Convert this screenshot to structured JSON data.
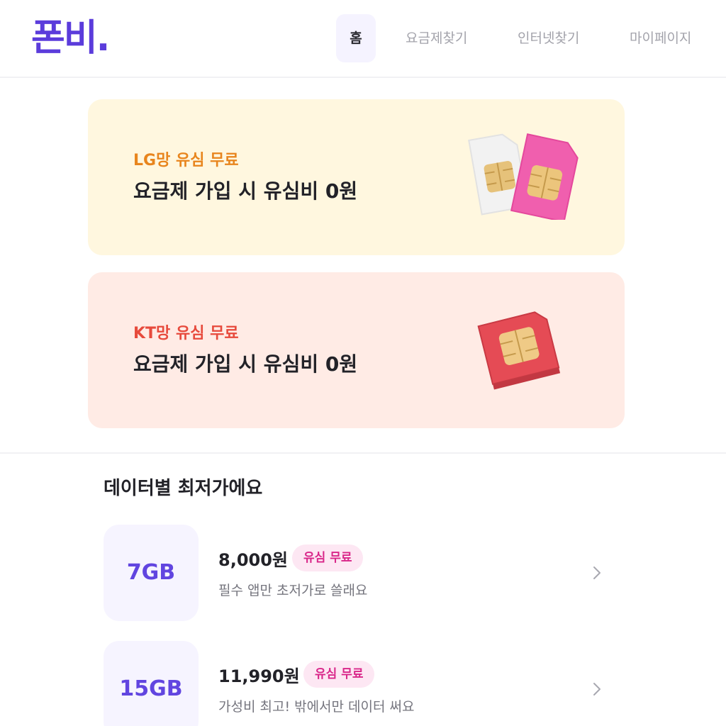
{
  "header": {
    "logo": "폰비.",
    "nav": {
      "home": "홈",
      "plan_search": "요금제찾기",
      "internet_search": "인터넷찾기",
      "my_page": "마이페이지"
    }
  },
  "banners": [
    {
      "tag": "LG망 유심 무료",
      "title": "요금제 가입 시 유심비 0원",
      "icon": "sim-card-icon"
    },
    {
      "tag": "KT망 유심 무료",
      "title": "요금제 가입 시 유심비 0원",
      "icon": "sim-card-icon"
    }
  ],
  "section": {
    "title": "데이터별 최저가에요"
  },
  "plans": [
    {
      "data": "7GB",
      "price": "8,000원",
      "badge": "유심 무료",
      "description": "필수 앱만 초저가로 쓸래요"
    },
    {
      "data": "15GB",
      "price": "11,990원",
      "badge": "유심 무료",
      "description": "가성비 최고! 밖에서만 데이터 써요"
    }
  ],
  "colors": {
    "brand": "#5b3cdb",
    "lg_banner_bg": "#fff7df",
    "kt_banner_bg": "#ffebe5",
    "badge_bg": "#fde7f3",
    "badge_text": "#d9278a"
  }
}
